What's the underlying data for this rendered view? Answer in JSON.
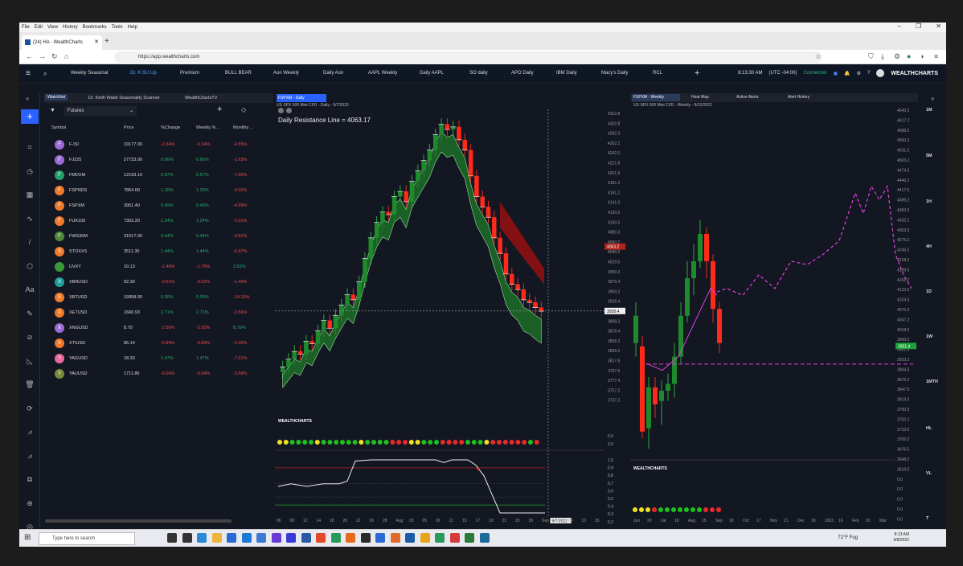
{
  "browser": {
    "menu": [
      "File",
      "Edit",
      "View",
      "History",
      "Bookmarks",
      "Tools",
      "Help"
    ],
    "tab_title": "(24) HA - WealthCharts",
    "url": "https://app.wealthcharts.com",
    "win_controls": [
      "–",
      "❐",
      "✕"
    ]
  },
  "apptabs": [
    "Weekly Seasonal",
    "Dr. K SU Up",
    "Premium",
    "BULL BEAR",
    "Aon Weekly",
    "Daily Aon",
    "AAPL Weekly",
    "Daily AAPL",
    "SO daily",
    "APO Daily",
    "IBM Daily",
    "Macy's Daily",
    "RCL"
  ],
  "app_right": {
    "time": "8:13:30 AM",
    "tz": "(UTC -04:00)",
    "status": "Connected",
    "brand": "WEALTHCHARTS",
    "add": "+"
  },
  "watch": {
    "tabs": [
      "Watchlist",
      "Dr. Keith Wade Seasonality Scanner",
      "WealthChartsTV"
    ],
    "filter": "Futures",
    "headers": [
      "Symbol",
      "Price",
      "%Change",
      "Weekly % ..",
      "Monthly .."
    ],
    "rows": [
      {
        "l": "F",
        "c": "#9c6ad6",
        "s": "F-ISI",
        "p": "19177.00",
        "ch": "-0.34%",
        "w": "-0.34%",
        "m": "-4.55%"
      },
      {
        "l": "F",
        "c": "#9c6ad6",
        "s": "FJ225",
        "p": "27723.00",
        "ch": "0.66%",
        "w": "0.66%",
        "m": "-1.63%"
      },
      {
        "l": "F",
        "c": "#22a06b",
        "s": "FMDXM",
        "p": "12193.10",
        "ch": "0.57%",
        "w": "0.57%",
        "m": "-7.65%"
      },
      {
        "l": "F",
        "c": "#f07a2a",
        "s": "FSPNDS",
        "p": "7864.00",
        "ch": "1.20%",
        "w": "1.20%",
        "m": "-4.02%"
      },
      {
        "l": "F",
        "c": "#f07a2a",
        "s": "FSPXM",
        "p": "3951.40",
        "ch": "0.49%",
        "w": "0.49%",
        "m": "-4.99%"
      },
      {
        "l": "F",
        "c": "#f07a2a",
        "s": "FUK100",
        "p": "7303.20",
        "ch": "1.24%",
        "w": "1.24%",
        "m": "-2.01%"
      },
      {
        "l": "F",
        "c": "#4f8a3c",
        "s": "FWS30M",
        "p": "31517.00",
        "ch": "0.44%",
        "w": "0.44%",
        "m": "-3.81%"
      },
      {
        "l": "S",
        "c": "#f07a2a",
        "s": "STOXXS",
        "p": "3511.30",
        "ch": "1.44%",
        "w": "1.44%",
        "m": "-5.97%"
      },
      {
        "l": "",
        "c": "#3a9a3a",
        "s": "UVXY",
        "p": "10.13",
        "ch": "-1.46%",
        "w": "-1.75%",
        "m": "2.53%"
      },
      {
        "l": "X",
        "c": "#22a0a0",
        "s": "XBRUSD",
        "p": "92.39",
        "ch": "-0.62%",
        "w": "-0.62%",
        "m": "-1.49%"
      },
      {
        "l": "X",
        "c": "#f07a2a",
        "s": "XBTUSD",
        "p": "19958.00",
        "ch": "0.00%",
        "w": "0.00%",
        "m": "-14.19%"
      },
      {
        "l": "X",
        "c": "#f07a2a",
        "s": "XETUSD",
        "p": "1660.93",
        "ch": "2.71%",
        "w": "2.71%",
        "m": "-3.56%"
      },
      {
        "l": "X",
        "c": "#9c6ad6",
        "s": "XNGUSD",
        "p": "8.70",
        "ch": "-2.50%",
        "w": "-2.50%",
        "m": "8.79%"
      },
      {
        "l": "X",
        "c": "#f07a2a",
        "s": "XTIUSD",
        "p": "86.14",
        "ch": "-0.89%",
        "w": "-0.89%",
        "m": "-2.00%"
      },
      {
        "l": "Y",
        "c": "#e86a9a",
        "s": "YAGUSD",
        "p": "18.33",
        "ch": "1.47%",
        "w": "1.47%",
        "m": "-7.21%"
      },
      {
        "l": "Y",
        "c": "#7a8a3c",
        "s": "YAUUSD",
        "p": "1711.86",
        "ch": "-0.04%",
        "w": "-0.04%",
        "m": "-3.58%"
      }
    ]
  },
  "chart1": {
    "tab": "FSPXM - Daily",
    "sub": "US SPX 500 Mini CFD  - Daily - 9/7/2022",
    "title": "Daily Resistance Line = 4063.17",
    "price_labels": [
      "4322.8",
      "4302.8",
      "4282.3",
      "4262.2",
      "4242.0",
      "4221.8",
      "4201.5",
      "4181.2",
      "4161.2",
      "4141.0",
      "4120.5",
      "4100.5",
      "4080.3",
      "4060.2",
      "4040.0",
      "4019.5",
      "3999.3",
      "3979.4",
      "3959.2",
      "3938.4",
      "3918.8",
      "3898.3",
      "3878.4",
      "3858.3",
      "3838.2",
      "3817.8",
      "3797.6",
      "3777.4",
      "3757.2",
      "3737.2"
    ],
    "tags": {
      "res": "4063.2",
      "cur": "3938.4"
    },
    "x_labels": [
      "06",
      "08",
      "12",
      "14",
      "18",
      "20",
      "22",
      "26",
      "28",
      "Aug",
      "03",
      "05",
      "09",
      "11",
      "15",
      "17",
      "19",
      "23",
      "25",
      "29",
      "Sep",
      "9/7/2022",
      "09",
      "13",
      "15"
    ],
    "osc_labels": [
      "0.0",
      "3.0"
    ],
    "osc2_labels": [
      "1.0",
      "0.9",
      "0.8",
      "0.7",
      "0.6",
      "0.5",
      "0.4",
      "0.3",
      "0.2",
      "0.1",
      "0.0"
    ],
    "logo": "WEALTHCHARTS"
  },
  "chart2": {
    "tabs": [
      "FSPXM - Weekly",
      "Heat Map",
      "Active Alerts",
      "Alert History"
    ],
    "sub": "US SPX 500 Mini CFD  - Weekly - 9/12/2022",
    "price_labels": [
      "4645.5",
      "4617.2",
      "4588.5",
      "4560.2",
      "4531.5",
      "4503.2",
      "4474.5",
      "4446.2",
      "4417.5",
      "4389.2",
      "4360.5",
      "4332.2",
      "4303.5",
      "4275.2",
      "4246.5",
      "4218.2",
      "4189.5",
      "4161.2",
      "4132.5",
      "4104.0",
      "4075.5",
      "4047.2",
      "4018.5",
      "3990.0",
      "3961.5",
      "3933.2",
      "3904.5",
      "3876.2",
      "3847.5",
      "3819.0",
      "3790.5",
      "3762.2",
      "3733.5",
      "3705.2",
      "3676.5",
      "3648.2",
      "3619.5",
      "0.0",
      "0.0",
      "0.0",
      "0.0",
      "0.0"
    ],
    "tag": "3951.4",
    "x_labels": [
      "Jun",
      "20",
      "Jul",
      "18",
      "Aug",
      "15",
      "Sep",
      "19",
      "Oct",
      "17",
      "Nov",
      "21",
      "Dec",
      "19",
      "2023",
      "16",
      "Feb",
      "20",
      "Mar"
    ],
    "logo": "WEALTHCHARTS"
  },
  "timeframes": [
    "1M",
    "5M",
    "1H",
    "4H",
    "1D",
    "1W",
    "1MTH",
    "HL",
    "VL",
    "T"
  ],
  "taskbar": {
    "search": "Type here to search",
    "weather": "72°F  Fog",
    "time": "8:13 AM",
    "date": "9/8/2022"
  },
  "chart_data": [
    {
      "type": "candlestick",
      "title": "Daily Resistance Line = 4063.17",
      "series": [
        {
          "name": "FSPXM - Daily"
        }
      ],
      "ylim": [
        3737.2,
        4322.8
      ],
      "resistance": 4063.17,
      "last": 3938.4
    },
    {
      "type": "candlestick",
      "series": [
        {
          "name": "FSPXM - Weekly"
        }
      ],
      "ylim": [
        3619.5,
        4645.5
      ],
      "last": 3951.4
    }
  ]
}
